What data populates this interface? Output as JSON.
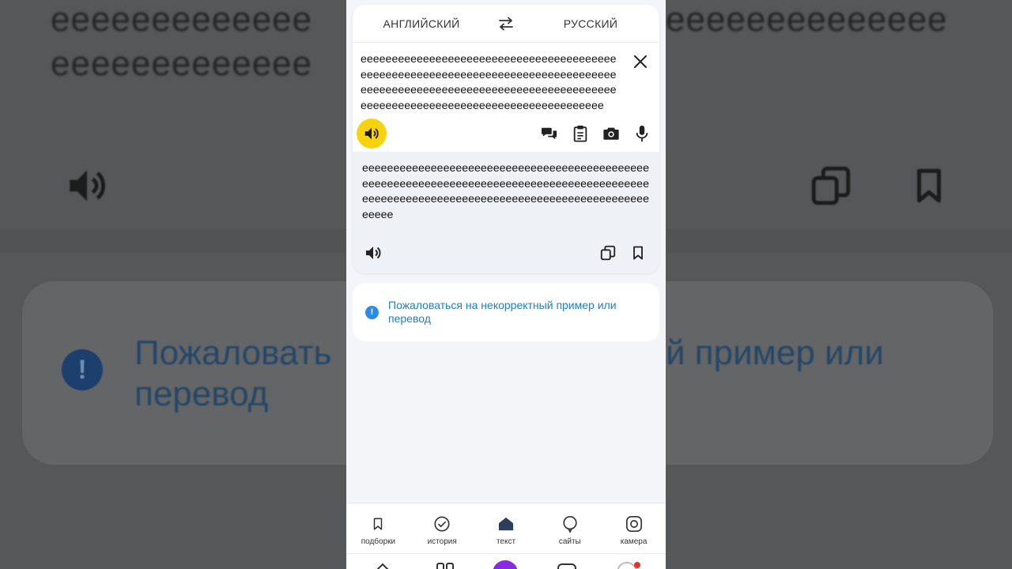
{
  "background": {
    "line1": "eeeeeeeeeeeee",
    "line1_right": "eeeeeeeeeeeeee",
    "line2": "eeeeeeeeeeeee",
    "report_line1_left": "Пожаловать",
    "report_line1_right": "й пример или",
    "report_line2": "перевод"
  },
  "lang_bar": {
    "source": "АНГЛИЙСКИЙ",
    "target": "РУССКИЙ",
    "swap_icon": "swap-arrows-icon"
  },
  "source_text": "eeeeeeeeeeeeeeeeeeeeeeeeeeeeeeeeeeeeeeeeeeeeeeeeeeeeeeeeeeeeeeeeeeeeeeeeeeeeeeeeeeeeeeeeeeeeeeeeeeeeeeeeeeeeeeeeeeeeeeeeeeeeeeeeeeeeeeeeeeeeeeeeeeeeeeeeeeeeeeeeee",
  "translation_text": "eeeeeeeeeeeeeeeeeeeeeeeeeeeeeeeeeeeeeeeeeeeeeeeeeeeeeeeeeeeeeeeeeeeeeeeeeeeeeeeeeeeeeeeeeeeeeeeeeeeeeeeeeeeeeeeeeeeeeeeeeeeeeeeeeeeeeeeeeeeeeee",
  "report": {
    "text": "Пожаловаться на некорректный пример или перевод"
  },
  "tabs": [
    {
      "label": "подборки",
      "icon": "bookmark-icon"
    },
    {
      "label": "история",
      "icon": "history-check-icon"
    },
    {
      "label": "текст",
      "icon": "home-text-icon"
    },
    {
      "label": "сайты",
      "icon": "sites-bubble-icon"
    },
    {
      "label": "камера",
      "icon": "camera-icon"
    }
  ],
  "colors": {
    "accent_yellow": "#f8d20f",
    "link_blue": "#1f7fc4",
    "info_blue": "#2a8ae8"
  }
}
